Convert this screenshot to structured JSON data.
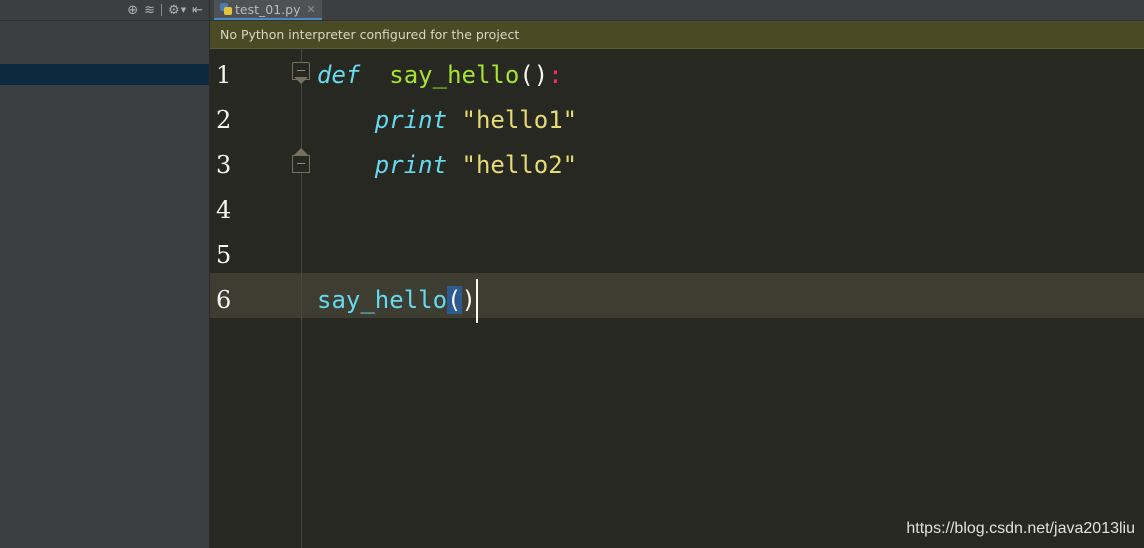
{
  "left_panel": {
    "toolbar_icons": [
      "target-icon",
      "collapse-all-icon",
      "gear-icon",
      "hide-panel-icon"
    ]
  },
  "tabs": [
    {
      "label": "test_01.py",
      "icon": "python-file-icon",
      "active": true
    }
  ],
  "banner": {
    "text": "No Python interpreter configured for the project"
  },
  "editor": {
    "lines": [
      {
        "number": "1",
        "tokens": [
          {
            "t": "def",
            "c": "kw"
          },
          {
            "t": "  ",
            "c": ""
          },
          {
            "t": "say_hello",
            "c": "fn"
          },
          {
            "t": "()",
            "c": "paren"
          },
          {
            "t": ":",
            "c": "colon"
          }
        ]
      },
      {
        "number": "2",
        "tokens": [
          {
            "t": "    ",
            "c": ""
          },
          {
            "t": "print",
            "c": "kw"
          },
          {
            "t": " ",
            "c": ""
          },
          {
            "t": "\"",
            "c": "str-q"
          },
          {
            "t": "hello1",
            "c": "str"
          },
          {
            "t": "\"",
            "c": "str-q"
          }
        ]
      },
      {
        "number": "3",
        "tokens": [
          {
            "t": "    ",
            "c": ""
          },
          {
            "t": "print",
            "c": "kw"
          },
          {
            "t": " ",
            "c": ""
          },
          {
            "t": "\"",
            "c": "str-q"
          },
          {
            "t": "hello2",
            "c": "str"
          },
          {
            "t": "\"",
            "c": "str-q"
          }
        ]
      },
      {
        "number": "4",
        "tokens": []
      },
      {
        "number": "5",
        "tokens": []
      },
      {
        "number": "6",
        "tokens": [
          {
            "t": "say_hello",
            "c": "call"
          },
          {
            "t": "(",
            "c": "paren-hl"
          },
          {
            "t": ")",
            "c": "paren"
          },
          {
            "t": "",
            "c": "caret"
          }
        ]
      }
    ],
    "current_line": 6
  },
  "watermark": "https://blog.csdn.net/java2013liu",
  "colors": {
    "background": "#272822",
    "keyword": "#66d9ef",
    "function": "#a6e22e",
    "string": "#e6db74",
    "colon": "#f92672",
    "banner": "#4a4a24"
  }
}
